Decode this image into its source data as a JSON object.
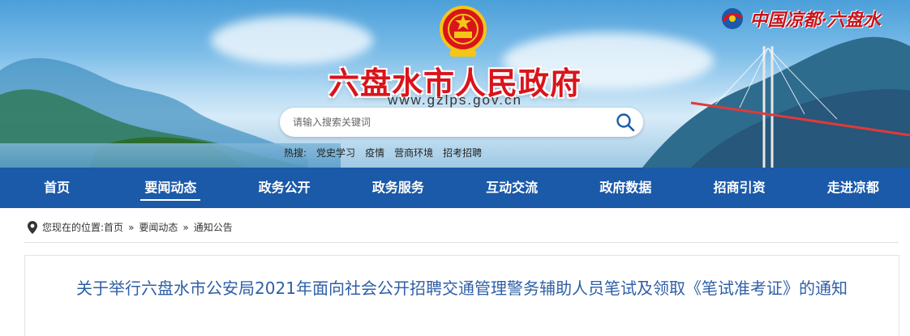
{
  "header": {
    "site_title": "六盘水市人民政府",
    "site_url": "www.gzlps.gov.cn",
    "brand": "中国凉都·六盘水",
    "search": {
      "placeholder": "请输入搜索关键词"
    },
    "hot": {
      "label": "热搜:",
      "items": [
        "党史学习",
        "疫情",
        "营商环境",
        "招考招聘"
      ]
    }
  },
  "nav": {
    "items": [
      "首页",
      "要闻动态",
      "政务公开",
      "政务服务",
      "互动交流",
      "政府数据",
      "招商引资",
      "走进凉都"
    ],
    "active_index": 1
  },
  "breadcrumb": {
    "prefix": "您现在的位置:",
    "items": [
      "首页",
      "要闻动态",
      "通知公告"
    ]
  },
  "article": {
    "title": "关于举行六盘水市公安局2021年面向社会公开招聘交通管理警务辅助人员笔试及领取《笔试准考证》的通知"
  },
  "colors": {
    "nav_bg": "#1b5aa9",
    "title_red": "#d9141b",
    "article_title": "#2f5fa6"
  },
  "icons": [
    "national-emblem-icon",
    "brand-logo-icon",
    "search-icon",
    "location-pin-icon"
  ]
}
